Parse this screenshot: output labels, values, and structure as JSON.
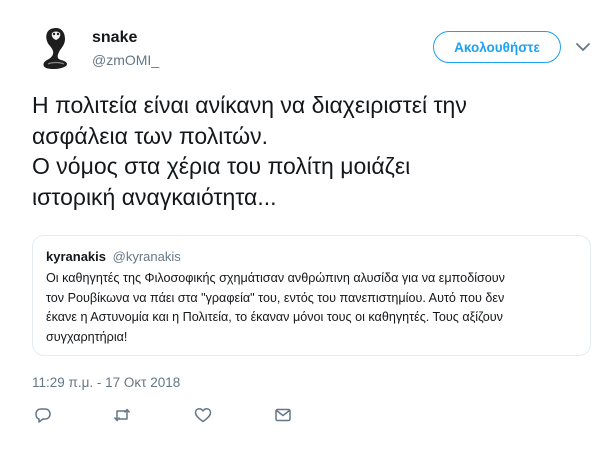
{
  "author": {
    "name": "snake",
    "handle": "@zmOMI_",
    "avatar_icon": "cobra-icon"
  },
  "follow_button": {
    "label": "Ακολουθήστε"
  },
  "tweet": {
    "lines": [
      "Η πολιτεία είναι ανίκανη να διαχειριστεί την",
      "ασφάλεια των πολιτών.",
      "Ο νόμος στα χέρια του πολίτη μοιάζει",
      "ιστορική αναγκαιότητα..."
    ]
  },
  "quoted_tweet": {
    "name": "kyranakis",
    "handle": "@kyranakis",
    "lines": [
      "Οι καθηγητές της Φιλοσοφικής σχημάτισαν ανθρώπινη αλυσίδα για να εμποδίσουν",
      "τον Ρουβίκωνα να πάει στα \"γραφεία\" του, εντός του πανεπιστημίου. Αυτό που δεν",
      "έκανε η Αστυνομία και η Πολιτεία, το έκαναν μόνοι τους οι καθηγητές. Τους αξίζουν",
      "συγχαρητήρια!"
    ]
  },
  "timestamp": "11:29 π.μ. - 17 Οκτ 2018",
  "actions": [
    "reply-icon",
    "retweet-icon",
    "like-icon",
    "message-icon"
  ],
  "colors": {
    "accent": "#1da1f2",
    "secondary_text": "#657786",
    "border": "#e6ecf0"
  }
}
